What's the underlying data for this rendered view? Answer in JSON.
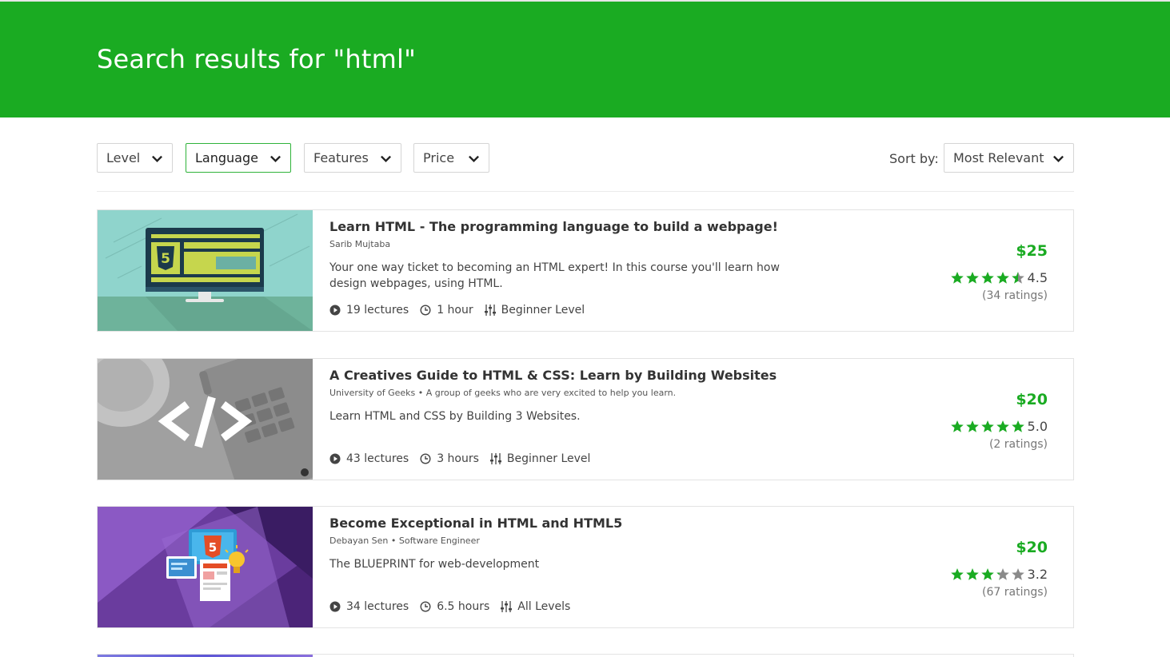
{
  "header": {
    "title": "Search results for \"html\"",
    "bg_color": "#1aab22"
  },
  "filters": [
    {
      "label": "Level",
      "active": false
    },
    {
      "label": "Language",
      "active": true
    },
    {
      "label": "Features",
      "active": false
    },
    {
      "label": "Price",
      "active": false
    }
  ],
  "sort": {
    "label": "Sort by:",
    "value": "Most Relevant"
  },
  "accent_color": "#1aab22",
  "courses": [
    {
      "title": "Learn HTML - The programming language to build a webpage!",
      "author": "Sarib Mujtaba",
      "description": "Your one way ticket to becoming an HTML expert! In this course you'll learn how design webpages, using HTML.",
      "lectures": "19 lectures",
      "duration": "1 hour",
      "level": "Beginner Level",
      "price": "$25",
      "rating": "4.5",
      "stars": 4.5,
      "ratings_count": "(34 ratings)",
      "thumbnail_icon": "html5-monitor-icon"
    },
    {
      "title": "A Creatives Guide to HTML & CSS: Learn by Building Websites",
      "author": "University of Geeks • A group of geeks who are very excited to help you learn.",
      "description": "Learn HTML and CSS by Building 3 Websites.",
      "lectures": "43 lectures",
      "duration": "3 hours",
      "level": "Beginner Level",
      "price": "$20",
      "rating": "5.0",
      "stars": 5,
      "ratings_count": "(2 ratings)",
      "thumbnail_icon": "code-brackets-icon"
    },
    {
      "title": "Become Exceptional in HTML and HTML5",
      "author": "Debayan Sen • Software Engineer",
      "description": "The BLUEPRINT for web-development",
      "lectures": "34 lectures",
      "duration": "6.5 hours",
      "level": "All Levels",
      "price": "$20",
      "rating": "3.2",
      "stars": 3.2,
      "ratings_count": "(67 ratings)",
      "thumbnail_icon": "html5-devices-icon"
    }
  ]
}
